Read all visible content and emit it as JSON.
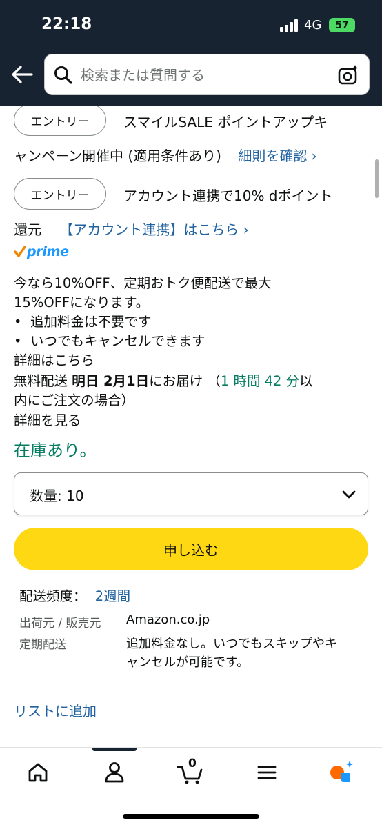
{
  "status_bar": {
    "time": "22:18",
    "network": "4G",
    "battery": "57"
  },
  "search": {
    "placeholder": "検索または質問する"
  },
  "promos": [
    {
      "button": "エントリー",
      "text_line1": "スマイルSALE ポイントアップキ",
      "text_line2": "ャンペーン開催中 (適用条件あり)",
      "link": "細則を確認 ›"
    },
    {
      "button": "エントリー",
      "text_line1": "アカウント連携で10% dポイント",
      "text_line2": "還元",
      "link": "【アカウント連携】はこちら ›"
    }
  ],
  "prime": {
    "label": "prime"
  },
  "subscription": {
    "line1": "今なら10%OFF、定期おトク便配送で最大",
    "line2": "15%OFFになります。",
    "bullets": [
      "追加料金は不要です",
      "いつでもキャンセルできます"
    ],
    "details_link": "詳細はこちら"
  },
  "delivery": {
    "prefix": "無料配送 ",
    "date": "明日 2月1日",
    "suffix": "にお届け （",
    "countdown": "1 時間 42 分",
    "tail": "以",
    "line2": "内にご注文の場合）",
    "details_link": "詳細を見る"
  },
  "stock": "在庫あり。",
  "quantity": {
    "label": "数量: 10"
  },
  "subscribe_button": "申し込む",
  "frequency": {
    "label": "配送頻度：",
    "value": "2週間"
  },
  "info": {
    "seller_label": "出荷元 / 販売元",
    "seller_value": "Amazon.co.jp",
    "regular_label": "定期配送",
    "regular_value_line1": "追加料金なし。いつでもスキップやキ",
    "regular_value_line2": "ャンセルが可能です。"
  },
  "add_to_list": "リストに追加",
  "nav": {
    "cart_count": "0"
  },
  "colors": {
    "header_bg": "#172331",
    "link": "#2162a1",
    "instock": "#067d62",
    "button_yellow": "#ffd814",
    "prime_blue": "#1a98ff",
    "prime_check": "#f08804"
  },
  "icons": [
    "back-arrow-icon",
    "search-icon",
    "camera-icon",
    "chevron-down-icon",
    "home-icon",
    "profile-icon",
    "cart-icon",
    "menu-icon",
    "rufus-icon"
  ]
}
